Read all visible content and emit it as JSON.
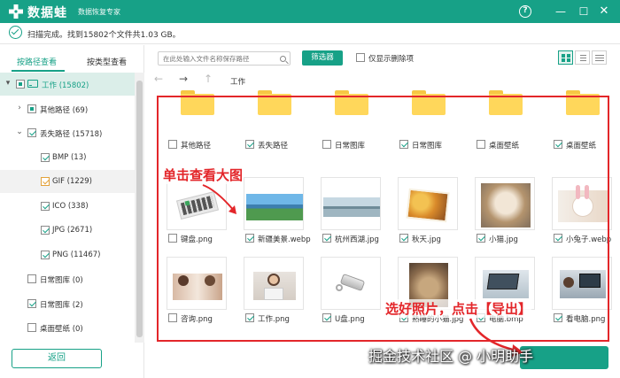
{
  "app": {
    "name": "数据蛙",
    "subtitle": "数据恢复专家"
  },
  "titlebar": {
    "help_icon": "?",
    "minimize_icon": "—",
    "maximize_icon": "☐",
    "close_icon": "✕"
  },
  "status": {
    "text": "扫描完成。找到15802个文件共1.03 GB。"
  },
  "sidebar": {
    "tabs": [
      {
        "label": "按路径查看",
        "active": true
      },
      {
        "label": "按类型查看",
        "active": false
      }
    ],
    "tree": [
      {
        "label": "工作 (15802)",
        "state": "partial",
        "arrow": "▾",
        "selected": true
      },
      {
        "label": "其他路径 (69)",
        "state": "partial",
        "arrow": "›"
      },
      {
        "label": "丢失路径 (15718)",
        "state": "checked",
        "arrow": "⌄"
      },
      {
        "label": "BMP (13)",
        "state": "checked"
      },
      {
        "label": "GIF (1229)",
        "state": "checked",
        "hover": true
      },
      {
        "label": "ICO (338)",
        "state": "checked"
      },
      {
        "label": "JPG (2671)",
        "state": "checked"
      },
      {
        "label": "PNG (11467)",
        "state": "checked"
      },
      {
        "label": "日常图库 (0)",
        "state": "unchecked"
      },
      {
        "label": "日常图库 (2)",
        "state": "checked"
      },
      {
        "label": "桌面壁纸 (0)",
        "state": "unchecked"
      }
    ],
    "back_button": "返回"
  },
  "toolbar": {
    "search_placeholder": "在此处输入文件名称保存路径",
    "filter_button": "筛选器",
    "only_deleted_label": "仅显示删除项"
  },
  "nav": {
    "back_icon": "←",
    "forward_icon": "→",
    "up_icon": "↑",
    "breadcrumb": "工作"
  },
  "files": [
    {
      "name": "其他路径",
      "kind": "folder",
      "checked": false,
      "partial": true
    },
    {
      "name": "丢失路径",
      "kind": "folder",
      "checked": true
    },
    {
      "name": "日常图库",
      "kind": "folder",
      "checked": false
    },
    {
      "name": "日常图库",
      "kind": "folder",
      "checked": true
    },
    {
      "name": "桌面壁纸",
      "kind": "folder",
      "checked": false
    },
    {
      "name": "桌面壁纸",
      "kind": "folder",
      "checked": true
    },
    {
      "name": "键盘.png",
      "kind": "keyboard",
      "checked": false
    },
    {
      "name": "新疆美景.webp",
      "kind": "landscape",
      "checked": true
    },
    {
      "name": "杭州西湖.jpg",
      "kind": "lake",
      "checked": true
    },
    {
      "name": "秋天.jpg",
      "kind": "autumn",
      "checked": true
    },
    {
      "name": "小猫.jpg",
      "kind": "cat",
      "checked": true
    },
    {
      "name": "小兔子.webp",
      "kind": "rabbit",
      "checked": true
    },
    {
      "name": "咨询.png",
      "kind": "people",
      "checked": false
    },
    {
      "name": "工作.png",
      "kind": "woman",
      "checked": true
    },
    {
      "name": "U盘.png",
      "kind": "usb",
      "checked": true
    },
    {
      "name": "熟睡的小猫.jpg",
      "kind": "sleepcat",
      "checked": true
    },
    {
      "name": "电脑.bmp",
      "kind": "laptop",
      "checked": true
    },
    {
      "name": "看电脑.png",
      "kind": "laptop2",
      "checked": true
    }
  ],
  "annotations": {
    "click_to_view": "单击查看大图",
    "select_and_export": "选好照片，点击【导出】"
  },
  "watermark": "掘金技术社区 @ 小明助手",
  "colors": {
    "brand": "#17a187",
    "annotation_red": "#e3262a",
    "folder_yellow": "#ffd75b"
  }
}
